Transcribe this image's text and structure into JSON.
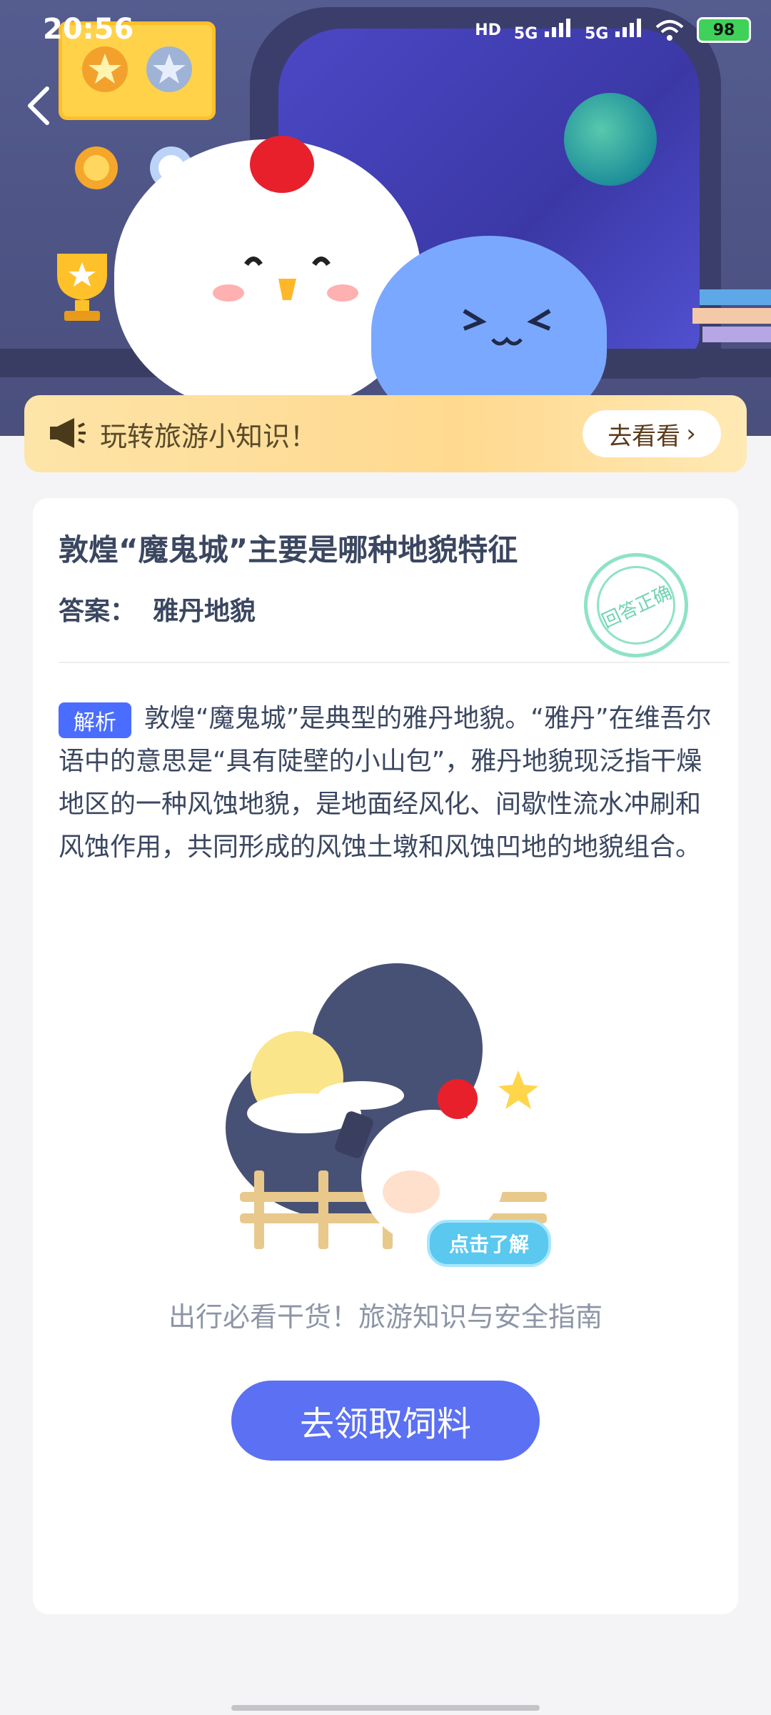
{
  "status_bar": {
    "time": "20:56",
    "network_labels": [
      "HD",
      "5G",
      "5G"
    ],
    "battery": "98"
  },
  "notice": {
    "text": "玩转旅游小知识！",
    "button_label": "去看看",
    "button_chevron": "›"
  },
  "question": {
    "title": "敦煌“魔鬼城”主要是哪种地貌特征",
    "answer_label": "答案：",
    "answer_value": "雅丹地貌",
    "stamp_text": "回答正确"
  },
  "analysis": {
    "tag": "解析",
    "text": "敦煌“魔鬼城”是典型的雅丹地貌。“雅丹”在维吾尔语中的意思是“具有陡壁的小山包”，雅丹地貌现泛指干燥地区的一种风蚀地貌，是地面经风化、间歇性流水冲刷和风蚀作用，共同形成的风蚀土墩和风蚀凹地的地貌组合。"
  },
  "promo": {
    "click_label": "点击了解",
    "caption": "出行必看干货！旅游知识与安全指南"
  },
  "cta": {
    "label": "去领取饲料"
  },
  "icons": {
    "back": "back-arrow-icon",
    "notice": "megaphone-icon",
    "wifi": "wifi-icon",
    "signal": "signal-icon"
  },
  "colors": {
    "accent": "#5b70f2",
    "tag": "#4a6dff",
    "banner": "#ffd98f",
    "stamp": "#8fe2c7"
  }
}
